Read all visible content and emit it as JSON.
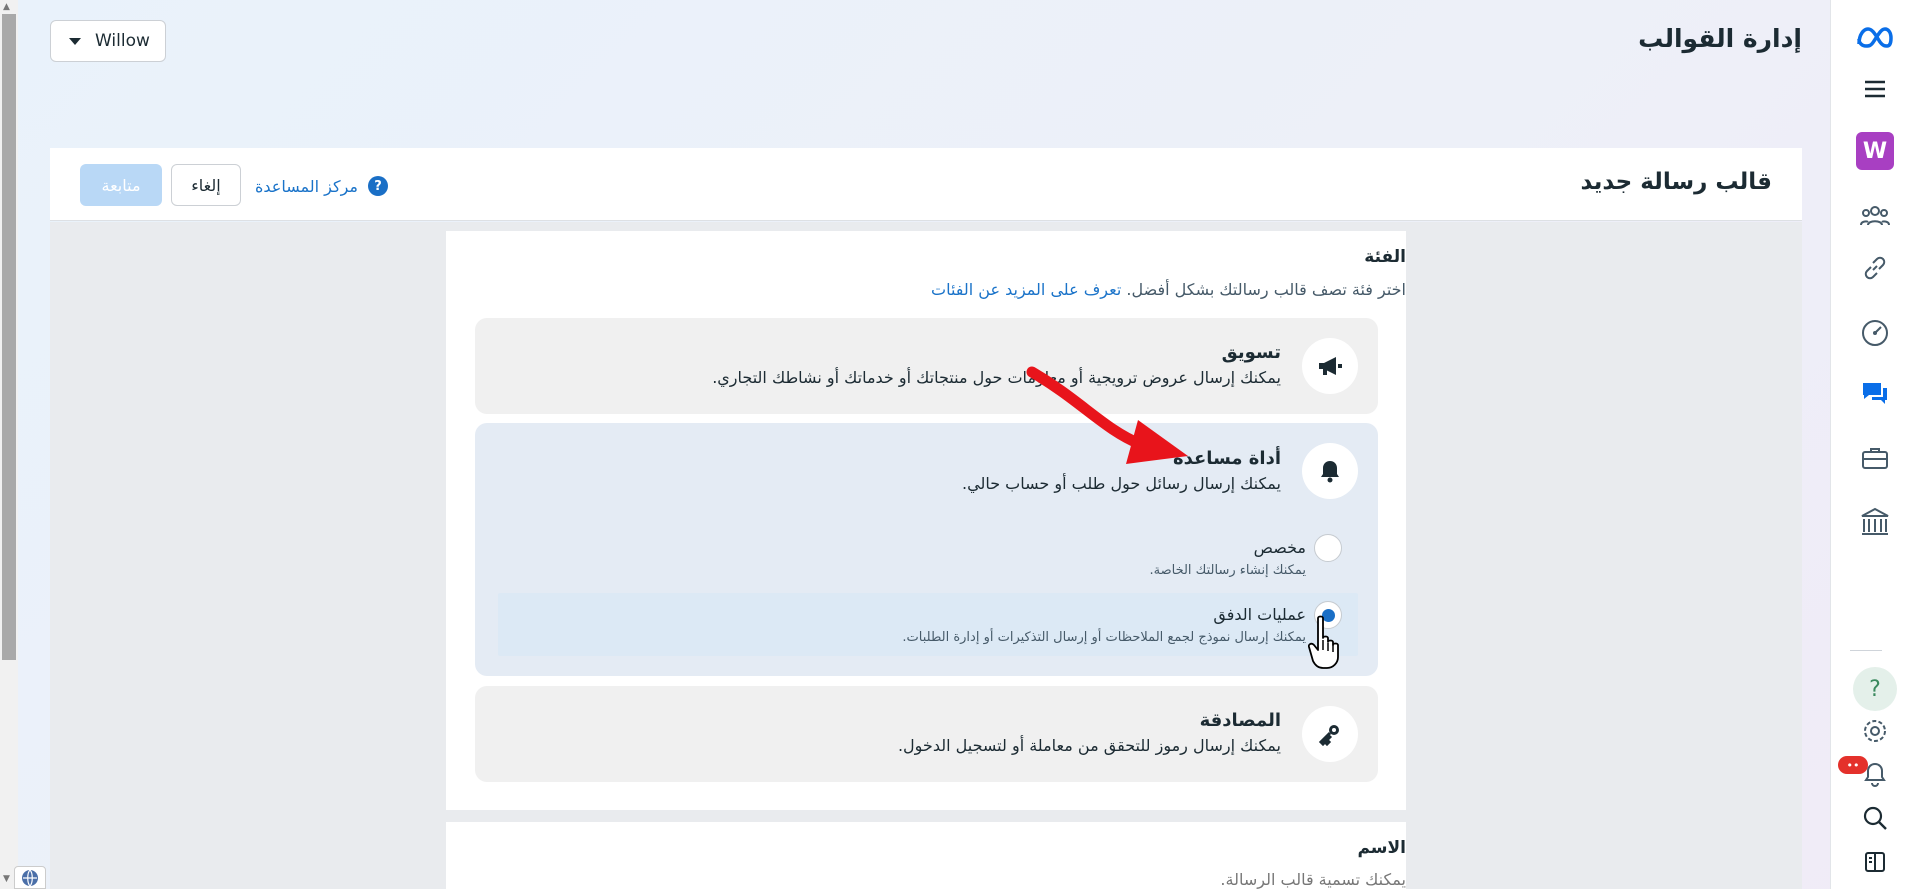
{
  "header": {
    "page_title": "إدارة القوالب",
    "account_name": "Willow"
  },
  "card": {
    "title": "قالب رسالة جديد",
    "continue_label": "متابعة",
    "cancel_label": "إلغاء",
    "help_label": "مركز المساعدة"
  },
  "category": {
    "title": "الفئة",
    "description": "اختر فئة تصف قالب رسالتك بشكل أفضل.",
    "learn_more": "تعرف على المزيد عن الفئات",
    "options": [
      {
        "title": "تسويق",
        "description": "يمكنك إرسال عروض ترويجية أو معلومات حول منتجاتك أو خدماتك أو نشاطك التجاري.",
        "icon": "megaphone-icon"
      },
      {
        "title": "أداة مساعدة",
        "description": "يمكنك إرسال رسائل حول طلب أو حساب حالي.",
        "icon": "bell-icon"
      },
      {
        "title": "المصادقة",
        "description": "يمكنك إرسال رموز للتحقق من معاملة أو لتسجيل الدخول.",
        "icon": "key-icon"
      }
    ],
    "utility_sub_options": [
      {
        "title": "مخصص",
        "description": "يمكنك إنشاء رسالتك الخاصة.",
        "selected": false
      },
      {
        "title": "عمليات الدفق",
        "description": "يمكنك إرسال نموذج لجمع الملاحظات أو إرسال التذكيرات أو إدارة الطلبات.",
        "selected": true
      }
    ]
  },
  "name_section": {
    "title": "الاسم",
    "description": "يمكنك تسمية قالب الرسالة."
  },
  "nav": {
    "avatar_letter": "W",
    "help_symbol": "?",
    "notification_count": "••"
  },
  "colors": {
    "accent": "#1a6fc6",
    "arrow_annotation": "#e8141b",
    "avatar": "#a83fc2"
  }
}
